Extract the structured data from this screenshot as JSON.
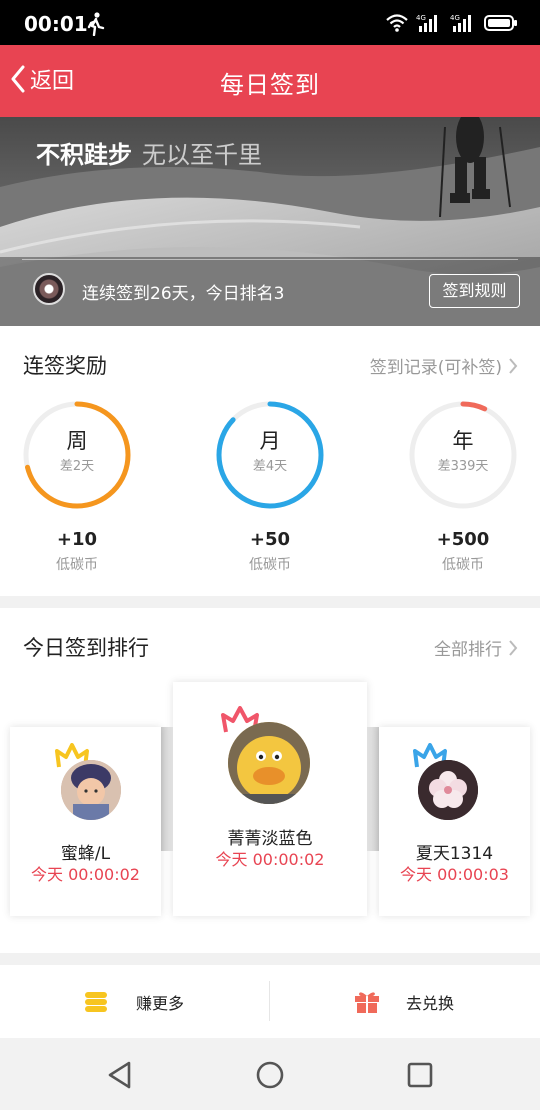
{
  "status_bar": {
    "time": "00:01",
    "icons": [
      "walk-icon",
      "wifi-icon",
      "signal-4g-icon",
      "signal-4g-icon",
      "battery-icon"
    ],
    "net_label": "4G"
  },
  "header": {
    "back_label": "返回",
    "title": "每日签到",
    "color": "#e84452"
  },
  "banner": {
    "slogan_strong": "不积跬步",
    "slogan_light": "无以至千里",
    "streak_text": "连续签到26天，今日排名3",
    "rules_button": "签到规则"
  },
  "reward": {
    "title": "连签奖励",
    "record_link": "签到记录(可补签)",
    "items": [
      {
        "label": "周",
        "remaining": "差2天",
        "value": "+10",
        "unit": "低碳币",
        "progress": 0.71,
        "color": "#f5961e"
      },
      {
        "label": "月",
        "remaining": "差4天",
        "value": "+50",
        "unit": "低碳币",
        "progress": 0.87,
        "color": "#2aa6e6"
      },
      {
        "label": "年",
        "remaining": "差339天",
        "value": "+500",
        "unit": "低碳币",
        "progress": 0.07,
        "color": "#f06a5a"
      }
    ]
  },
  "ranking": {
    "title": "今日签到排行",
    "all_link": "全部排行",
    "entries": [
      {
        "rank": 2,
        "name": "蜜蜂/L",
        "time": "今天 00:00:02",
        "crown_color": "#f7c520"
      },
      {
        "rank": 1,
        "name": "菁菁淡蓝色",
        "time": "今天 00:00:02",
        "crown_color": "#f0566a"
      },
      {
        "rank": 3,
        "name": "夏天1314",
        "time": "今天 00:00:03",
        "crown_color": "#3aa4e8"
      }
    ]
  },
  "actions": {
    "earn_label": "赚更多",
    "exchange_label": "去兑换"
  },
  "navbar": {
    "icons": [
      "back-triangle-icon",
      "home-circle-icon",
      "recents-square-icon"
    ]
  }
}
